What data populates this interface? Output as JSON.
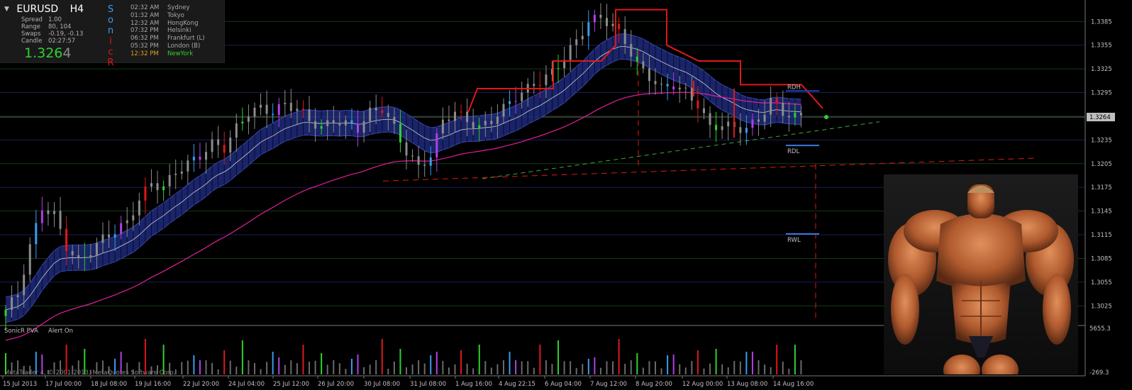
{
  "info": {
    "symbol": "EURUSD",
    "timeframe": "H4",
    "rows": [
      {
        "label": "Spread",
        "value": "1.00"
      },
      {
        "label": "Range",
        "value": "80, 104"
      },
      {
        "label": "Swaps",
        "value": "-0.19, -0.13"
      },
      {
        "label": "Candle",
        "value": "02:27:57"
      }
    ],
    "price_main": "1.326",
    "price_last": "4",
    "sonicr": [
      "S",
      "o",
      "n",
      "i",
      "c",
      "R"
    ],
    "sessions": [
      {
        "time": "02:32 AM",
        "city": "Sydney"
      },
      {
        "time": "01:32 AM",
        "city": "Tokyo"
      },
      {
        "time": "12:32 AM",
        "city": "HongKong"
      },
      {
        "time": "07:32 PM",
        "city": "Helsinki"
      },
      {
        "time": "06:32 PM",
        "city": "Frankfurt  (L)"
      },
      {
        "time": "05:32 PM",
        "city": "London  (B)"
      },
      {
        "time": "12:32 PM",
        "city": "NewYork"
      }
    ]
  },
  "colors": {
    "bull": "#2fd12f",
    "bear": "#e01818",
    "neutral": "#8c8c8c",
    "climax_up": "#3a9cf0",
    "climax_dn": "#b040e8",
    "ribbon": "#1f2a7a",
    "ma": "#e0209a",
    "level": "#e01818",
    "grid": "#333333"
  },
  "footer": {
    "indicator": "SonicR PVA",
    "alert": "Alert On",
    "copyright": "MetaTrader 4, © 2001-2013, MetaQuotes Software Corp.",
    "vol_top": "5655.3",
    "vol_bottom": "-269.3"
  },
  "chart_data": {
    "type": "candlestick",
    "ylim": [
      1.301,
      1.3405
    ],
    "y_ticks": [
      "1.3385",
      "1.3355",
      "1.3325",
      "1.3295",
      "1.3265",
      "1.3235",
      "1.3205",
      "1.3175",
      "1.3145",
      "1.3115",
      "1.3085",
      "1.3055",
      "1.3025"
    ],
    "current_price": "1.3264",
    "x_labels": [
      "15 Jul 2013",
      "17 Jul 00:00",
      "18 Jul 08:00",
      "19 Jul 16:00",
      "22 Jul 20:00",
      "24 Jul 04:00",
      "25 Jul 12:00",
      "26 Jul 20:00",
      "30 Jul 08:00",
      "31 Jul 08:00",
      "1 Aug 16:00",
      "4 Aug 22:15",
      "6 Aug 04:00",
      "7 Aug 12:00",
      "8 Aug 20:00",
      "12 Aug 00:00",
      "13 Aug 08:00",
      "14 Aug 16:00"
    ],
    "levels": [
      {
        "label": "RDH",
        "value": 1.3297
      },
      {
        "label": "RDL",
        "value": 1.3228
      },
      {
        "label": "RWL",
        "value": 1.3116
      }
    ],
    "close_path": [
      1.302,
      1.304,
      1.31,
      1.315,
      1.314,
      1.31,
      1.308,
      1.3095,
      1.311,
      1.312,
      1.313,
      1.316,
      1.318,
      1.3175,
      1.3195,
      1.3205,
      1.3215,
      1.323,
      1.3225,
      1.325,
      1.327,
      1.3275,
      1.327,
      1.328,
      1.3275,
      1.326,
      1.325,
      1.326,
      1.3255,
      1.325,
      1.327,
      1.3275,
      1.325,
      1.322,
      1.32,
      1.3215,
      1.326,
      1.327,
      1.326,
      1.325,
      1.326,
      1.3275,
      1.329,
      1.33,
      1.331,
      1.332,
      1.334,
      1.336,
      1.3385,
      1.339,
      1.338,
      1.336,
      1.333,
      1.3315,
      1.33,
      1.3305,
      1.3295,
      1.328,
      1.325,
      1.3255,
      1.325,
      1.325,
      1.326,
      1.3285,
      1.327,
      1.3264
    ]
  }
}
